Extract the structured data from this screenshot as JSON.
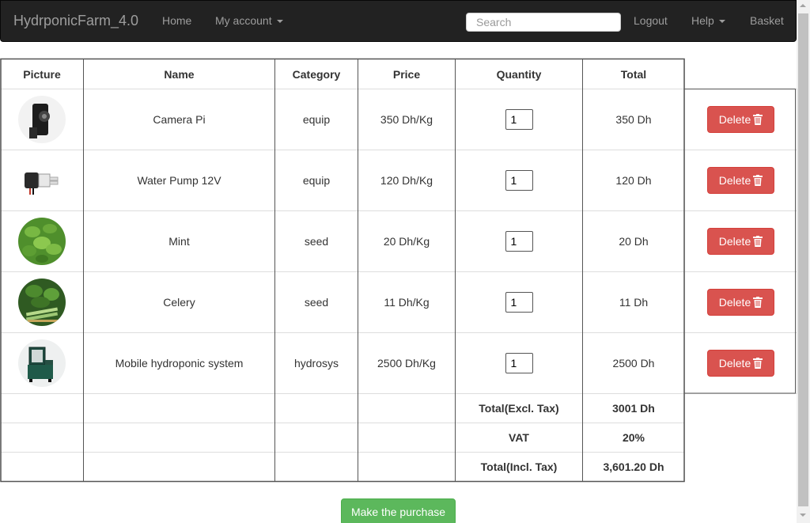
{
  "navbar": {
    "brand": "HydrponicFarm_4.0",
    "home": "Home",
    "my_account": "My account",
    "search_placeholder": "Search",
    "logout": "Logout",
    "help": "Help",
    "basket": "Basket"
  },
  "table": {
    "headers": [
      "Picture",
      "Name",
      "Category",
      "Price",
      "Quantity",
      "Total"
    ],
    "rows": [
      {
        "picture": "camera-pi-image",
        "name": "Camera Pi",
        "category": "equip",
        "price": "350 Dh/Kg",
        "quantity": "1",
        "total": "350 Dh"
      },
      {
        "picture": "water-pump-image",
        "name": "Water Pump 12V",
        "category": "equip",
        "price": "120 Dh/Kg",
        "quantity": "1",
        "total": "120 Dh"
      },
      {
        "picture": "mint-image",
        "name": "Mint",
        "category": "seed",
        "price": "20 Dh/Kg",
        "quantity": "1",
        "total": "20 Dh"
      },
      {
        "picture": "celery-image",
        "name": "Celery",
        "category": "seed",
        "price": "11 Dh/Kg",
        "quantity": "1",
        "total": "11 Dh"
      },
      {
        "picture": "mobile-hydroponic-image",
        "name": "Mobile hydroponic system",
        "category": "hydrosys",
        "price": "2500 Dh/Kg",
        "quantity": "1",
        "total": "2500 Dh"
      }
    ],
    "delete_label": "Delete",
    "summary": {
      "excl_label": "Total(Excl. Tax)",
      "excl_value": "3001 Dh",
      "vat_label": "VAT",
      "vat_value": "20%",
      "incl_label": "Total(Incl. Tax)",
      "incl_value": "3,601.20 Dh"
    }
  },
  "purchase_label": "Make the purchase",
  "colors": {
    "navbar_bg": "#222222",
    "danger": "#d9534f",
    "success": "#5cb85c"
  }
}
